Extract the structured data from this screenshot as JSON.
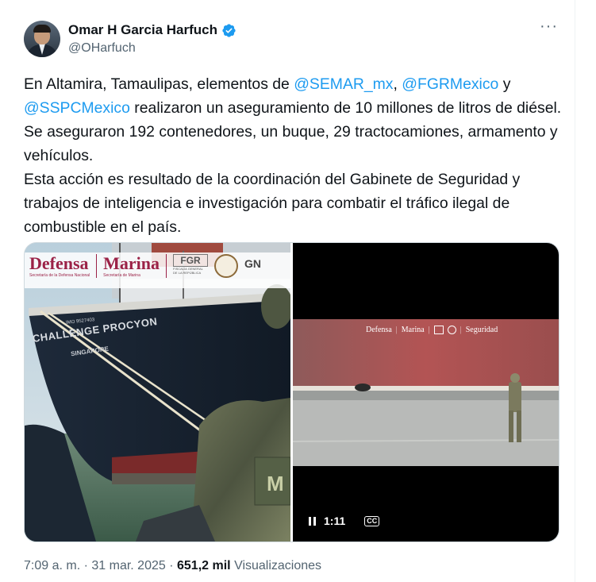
{
  "author": {
    "display_name": "Omar H Garcia Harfuch",
    "handle": "@OHarfuch",
    "verified": true,
    "verified_color": "#1d9bf0"
  },
  "menu": {
    "more_icon": "more-horizontal-icon",
    "more_label": "···"
  },
  "tweet": {
    "seg1": "En Altamira, Tamaulipas, elementos de ",
    "mention1": "@SEMAR_mx",
    "seg2": ", ",
    "mention2": "@FGRMexico",
    "seg3": " y\n",
    "mention3": "@SSPCMexico",
    "seg4": " realizaron un aseguramiento de 10 millones de litros de diésel. Se aseguraron 192 contenedores, un buque, 29 tractocamiones, armamento y vehículos.\nEsta acción es resultado de la coordinación del Gabinete de Seguridad y trabajos de inteligencia e investigación para combatir el tráfico ilegal de combustible en el país."
  },
  "photo": {
    "logo_defensa": "Defensa",
    "logo_defensa_sub": "Secretaría de la Defensa Nacional",
    "logo_marina": "Marina",
    "logo_marina_sub": "Secretaría de Marina",
    "logo_fgr": "FGR",
    "logo_fgr_sub": "FISCALÍA GENERAL DE LA REPÚBLICA",
    "logo_gn": "GN",
    "ship_name": "CHALLENGE PROCYON",
    "ship_port": "SINGAPORE",
    "ship_imo": "IMO 9527403",
    "vest_letter": "M"
  },
  "video": {
    "banner_defensa": "Defensa",
    "banner_marina": "Marina",
    "banner_seguridad": "Seguridad",
    "time": "1:11",
    "cc_label": "CC"
  },
  "footer": {
    "time": "7:09 a. m.",
    "sep": " · ",
    "date": "31 mar. 2025",
    "views_count": "651,2 mil",
    "views_label": "Visualizaciones"
  },
  "colors": {
    "accent": "#1d9bf0",
    "text": "#0f1419",
    "secondary": "#536471",
    "marina_red": "#9b2247"
  }
}
